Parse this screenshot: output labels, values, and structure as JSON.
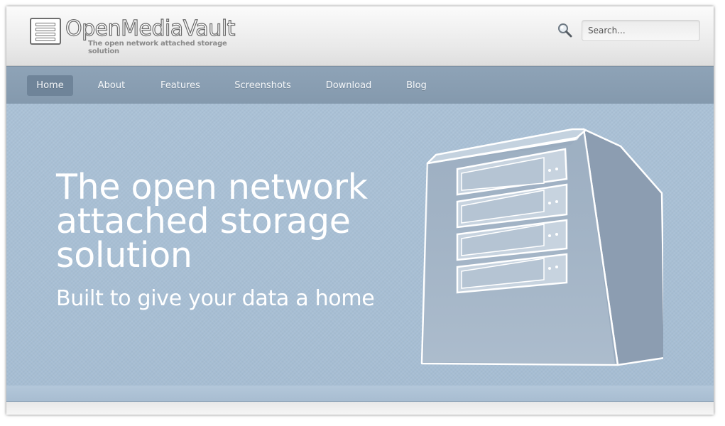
{
  "header": {
    "logo_name": "OpenMediaVault",
    "logo_tagline": "The open network attached storage solution",
    "search_icon": "search-icon",
    "search_placeholder": "Search..."
  },
  "nav": {
    "items": [
      {
        "label": "Home",
        "active": true
      },
      {
        "label": "About",
        "active": false
      },
      {
        "label": "Features",
        "active": false
      },
      {
        "label": "Screenshots",
        "active": false
      },
      {
        "label": "Download",
        "active": false
      },
      {
        "label": "Blog",
        "active": false
      }
    ]
  },
  "hero": {
    "headline_lines": [
      "The open network",
      "attached storage",
      "solution"
    ],
    "subline": "Built to give your data a home",
    "illustration": "nas-server-illustration"
  },
  "colors": {
    "hero_bg": "#a9c0d5",
    "nav_bg": "#8a9fb3",
    "nav_active": "#6f8499",
    "header_bg": "#eeeeee"
  }
}
